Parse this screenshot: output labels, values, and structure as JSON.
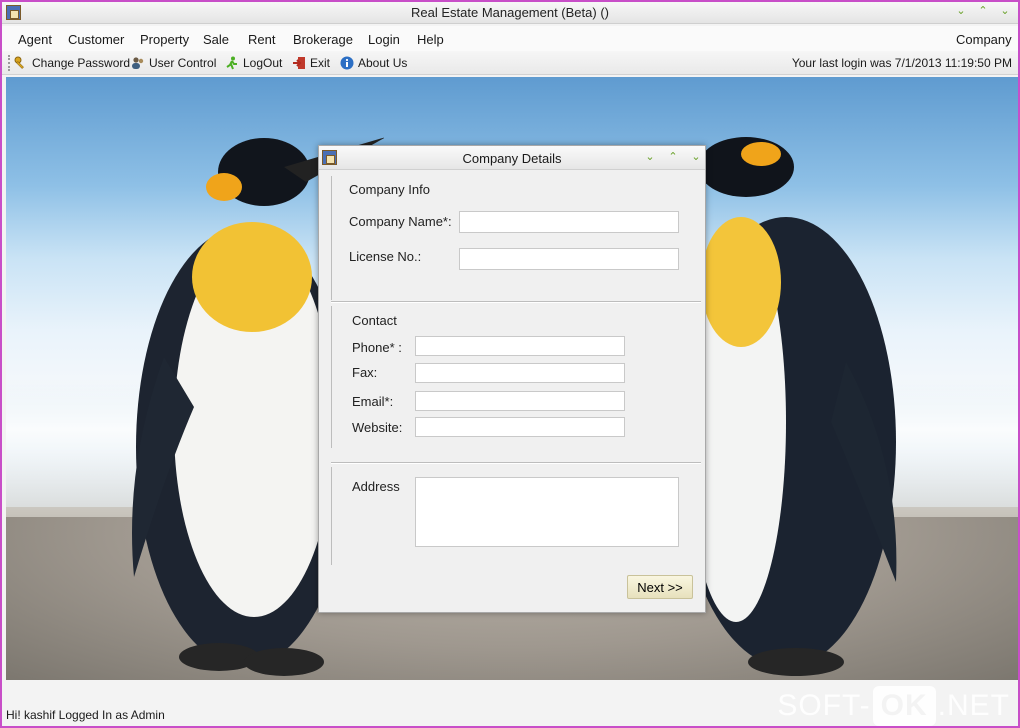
{
  "window": {
    "title": "Real Estate Management (Beta) ()",
    "controls": [
      "⌄",
      "⌃",
      "⌄"
    ]
  },
  "menubar": {
    "items": [
      "Agent",
      "Customer",
      "Property",
      "Sale",
      "Rent",
      "Brokerage",
      "Login",
      "Help"
    ],
    "right_label": "Company"
  },
  "toolbar": {
    "change_password": "Change Password",
    "user_control": "User Control",
    "logout": "LogOut",
    "exit": "Exit",
    "about": "About Us",
    "last_login": "Your last login was 7/1/2013 11:19:50 PM"
  },
  "dialog": {
    "title": "Company Details",
    "company_info_heading": "Company Info",
    "company_name_label": "Company Name*:",
    "company_name_value": "",
    "license_label": "License No.:",
    "license_value": "",
    "contact_heading": "Contact",
    "phone_label": "Phone* :",
    "phone_value": "",
    "fax_label": "Fax:",
    "fax_value": "",
    "email_label": "Email*:",
    "email_value": "",
    "website_label": "Website:",
    "website_value": "",
    "address_label": "Address",
    "address_value": "",
    "next_label": "Next >>"
  },
  "status": {
    "text": "Hi! kashif  Logged In as Admin"
  },
  "watermark": {
    "soft": "SOFT-",
    "ok": "OK",
    "net": ".NET"
  },
  "colors": {
    "window_border": "#c84ec8",
    "accent_green": "#6aa22a",
    "next_button": "#ece6c6"
  },
  "icons": [
    "app-icon",
    "key-icon",
    "users-icon",
    "run-icon",
    "exit-icon",
    "info-icon"
  ]
}
